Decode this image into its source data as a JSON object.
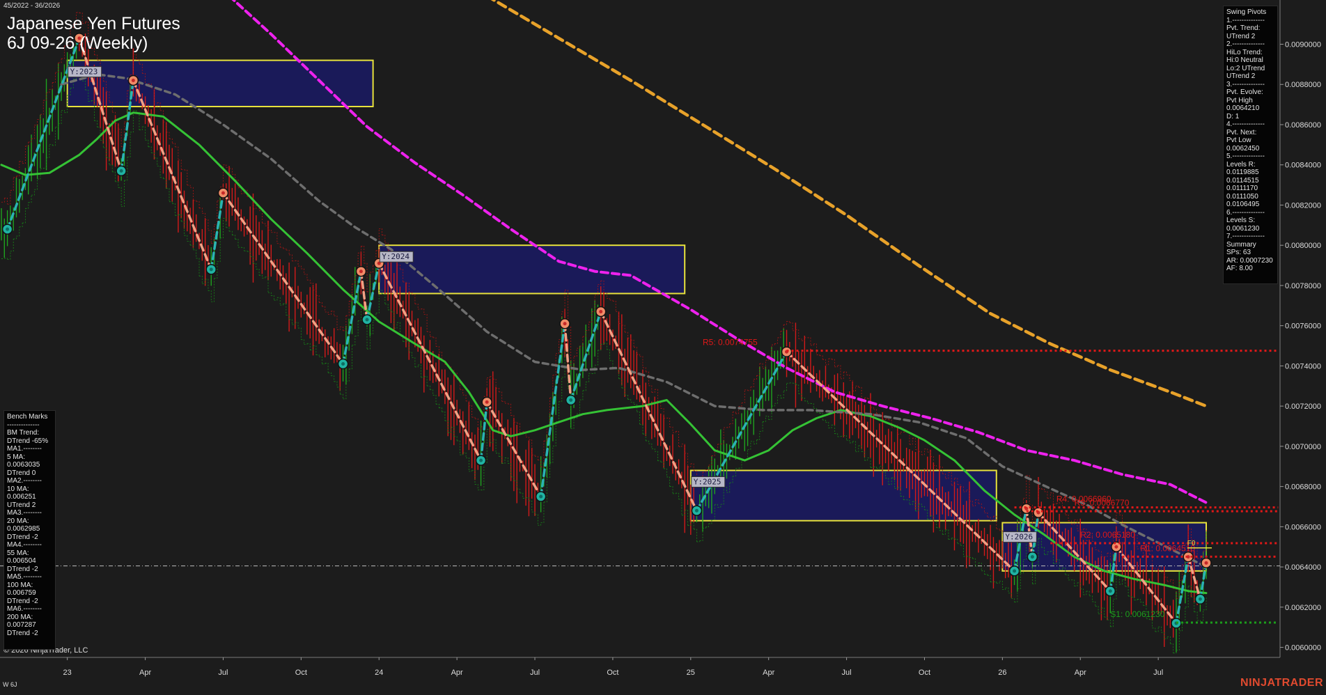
{
  "header": {
    "date_range": "45/2022 - 36/2026",
    "title": "Japanese Yen Futures",
    "subtitle": "6J 09-26 (Weekly)"
  },
  "footer": {
    "copyright": "© 2026 NinjaTrader, LLC",
    "series_label": "W 6J",
    "brand": "NINJATRADER"
  },
  "swing_panel": {
    "lines": [
      "Swing Pivots",
      "1.--------------",
      "Pvt. Trend:",
      "UTrend 2",
      "2.--------------",
      "HiLo Trend:",
      "Hi:0 Neutral",
      "Lo:2 UTrend",
      "UTrend 2",
      "3.--------------",
      "Pvt. Evolve:",
      "Pvt High",
      "0.0064210",
      "D: 1",
      "4.--------------",
      "Pvt. Next:",
      "Pvt Low",
      "0.0062450",
      "5.--------------",
      "Levels R:",
      "0.0119885",
      "0.0114515",
      "0.0111170",
      "0.0111050",
      "0.0106495",
      "6.--------------",
      "Levels S:",
      "0.0061230",
      "7.--------------",
      "Summary",
      "SPs: 63",
      "AR: 0.0007230",
      "AF: 8.00"
    ]
  },
  "bench_panel": {
    "lines": [
      "Bench Marks",
      "--------------",
      "BM Trend:",
      "DTrend -65%",
      "MA1.--------",
      "5 MA:",
      "0.0063035",
      "DTrend 0",
      "MA2.--------",
      "10 MA:",
      "0.006251",
      "UTrend 2",
      "MA3.--------",
      "20 MA:",
      "0.0062985",
      "DTrend -2",
      "MA4.--------",
      "55 MA:",
      "0.006504",
      "DTrend -2",
      "MA5.--------",
      "100 MA:",
      "0.006759",
      "DTrend -2",
      "MA6.--------",
      "200 MA:",
      "0.007287",
      "DTrend -2"
    ]
  },
  "colors": {
    "background": "#1c1c1c",
    "up_bar": "#1fa31f",
    "down_bar": "#d21a1a",
    "ma_green": "#35c235",
    "ma_gray": "#6e6e6e",
    "ma_magenta": "#ee22ee",
    "ma_orange": "#e8a22a",
    "swing_up": "#2ab3b3",
    "swing_down": "#f2a084",
    "resistance": "#e01818",
    "support": "#1c9e1c",
    "zone_fill": "#1a1a5e",
    "zone_border": "#e8e23c"
  },
  "chart_data": {
    "type": "line",
    "instrument": "6J 09-26",
    "timeframe": "Weekly",
    "ylim": [
      0.00595,
      0.00922
    ],
    "y_ticks": [
      "0.0090000",
      "0.0088000",
      "0.0086000",
      "0.0084000",
      "0.0082000",
      "0.0080000",
      "0.0078000",
      "0.0076000",
      "0.0074000",
      "0.0072000",
      "0.0070000",
      "0.0068000",
      "0.0066000",
      "0.0064000",
      "0.0062000",
      "0.0060000"
    ],
    "y_tick_values": [
      0.009,
      0.0088,
      0.0086,
      0.0084,
      0.0082,
      0.008,
      0.0078,
      0.0076,
      0.0074,
      0.0072,
      0.007,
      0.0068,
      0.0066,
      0.0064,
      0.0062,
      0.006
    ],
    "x_ticks": [
      {
        "label": "23",
        "week": 0
      },
      {
        "label": "Apr",
        "week": 13
      },
      {
        "label": "Jul",
        "week": 26
      },
      {
        "label": "Oct",
        "week": 39
      },
      {
        "label": "24",
        "week": 52
      },
      {
        "label": "Apr",
        "week": 65
      },
      {
        "label": "Jul",
        "week": 78
      },
      {
        "label": "Oct",
        "week": 91
      },
      {
        "label": "25",
        "week": 104
      },
      {
        "label": "Apr",
        "week": 117
      },
      {
        "label": "Jul",
        "week": 130
      },
      {
        "label": "Oct",
        "week": 143
      },
      {
        "label": "26",
        "week": 156
      },
      {
        "label": "Apr",
        "week": 169
      },
      {
        "label": "Jul",
        "week": 182
      }
    ],
    "x_range_weeks": [
      -11,
      190
    ],
    "swing_pivots": [
      {
        "w": -10,
        "v": 0.00808,
        "t": "L"
      },
      {
        "w": 2,
        "v": 0.00903,
        "t": "H"
      },
      {
        "w": 9,
        "v": 0.00837,
        "t": "L"
      },
      {
        "w": 11,
        "v": 0.00882,
        "t": "H"
      },
      {
        "w": 24,
        "v": 0.00788,
        "t": "L"
      },
      {
        "w": 26,
        "v": 0.00826,
        "t": "H"
      },
      {
        "w": 46,
        "v": 0.00741,
        "t": "L"
      },
      {
        "w": 49,
        "v": 0.00787,
        "t": "H"
      },
      {
        "w": 50,
        "v": 0.00763,
        "t": "L"
      },
      {
        "w": 52,
        "v": 0.00791,
        "t": "H"
      },
      {
        "w": 69,
        "v": 0.00693,
        "t": "L"
      },
      {
        "w": 70,
        "v": 0.00722,
        "t": "H"
      },
      {
        "w": 79,
        "v": 0.00675,
        "t": "L"
      },
      {
        "w": 83,
        "v": 0.00761,
        "t": "H"
      },
      {
        "w": 84,
        "v": 0.00723,
        "t": "L"
      },
      {
        "w": 89,
        "v": 0.00767,
        "t": "H"
      },
      {
        "w": 105,
        "v": 0.00668,
        "t": "L"
      },
      {
        "w": 120,
        "v": 0.00747,
        "t": "H"
      },
      {
        "w": 158,
        "v": 0.00638,
        "t": "L"
      },
      {
        "w": 160,
        "v": 0.00669,
        "t": "H"
      },
      {
        "w": 161,
        "v": 0.00645,
        "t": "L"
      },
      {
        "w": 162,
        "v": 0.00667,
        "t": "H"
      },
      {
        "w": 174,
        "v": 0.00628,
        "t": "L"
      },
      {
        "w": 175,
        "v": 0.0065,
        "t": "H"
      },
      {
        "w": 185,
        "v": 0.00612,
        "t": "L"
      },
      {
        "w": 187,
        "v": 0.00645,
        "t": "H"
      },
      {
        "w": 189,
        "v": 0.00624,
        "t": "L"
      },
      {
        "w": 190,
        "v": 0.00642,
        "t": "H"
      }
    ],
    "moving_averages": [
      {
        "name": "MA green",
        "color": "#35c235",
        "dash": "",
        "width": 3,
        "points": [
          [
            -11,
            0.0084
          ],
          [
            -7,
            0.00835
          ],
          [
            -3,
            0.00836
          ],
          [
            2,
            0.00845
          ],
          [
            5,
            0.00853
          ],
          [
            8,
            0.00862
          ],
          [
            11,
            0.00866
          ],
          [
            16,
            0.00864
          ],
          [
            22,
            0.0085
          ],
          [
            28,
            0.00832
          ],
          [
            34,
            0.00813
          ],
          [
            40,
            0.00796
          ],
          [
            46,
            0.00778
          ],
          [
            52,
            0.00762
          ],
          [
            58,
            0.00751
          ],
          [
            63,
            0.00742
          ],
          [
            67,
            0.00727
          ],
          [
            71,
            0.00708
          ],
          [
            74,
            0.00705
          ],
          [
            78,
            0.00708
          ],
          [
            82,
            0.00712
          ],
          [
            86,
            0.00716
          ],
          [
            90,
            0.00718
          ],
          [
            96,
            0.0072
          ],
          [
            100,
            0.00723
          ],
          [
            104,
            0.00711
          ],
          [
            108,
            0.00698
          ],
          [
            113,
            0.00693
          ],
          [
            117,
            0.00698
          ],
          [
            121,
            0.00708
          ],
          [
            125,
            0.00714
          ],
          [
            129,
            0.00718
          ],
          [
            134,
            0.00715
          ],
          [
            139,
            0.00709
          ],
          [
            143,
            0.00703
          ],
          [
            148,
            0.00693
          ],
          [
            153,
            0.00678
          ],
          [
            158,
            0.00666
          ],
          [
            163,
            0.00656
          ],
          [
            168,
            0.00645
          ],
          [
            173,
            0.00638
          ],
          [
            178,
            0.00634
          ],
          [
            183,
            0.00631
          ],
          [
            187,
            0.00628
          ],
          [
            190,
            0.00627
          ]
        ]
      },
      {
        "name": "MA gray",
        "color": "#6e6e6e",
        "dash": "8 6",
        "width": 3.5,
        "points": [
          [
            -1,
            0.0088
          ],
          [
            5,
            0.00885
          ],
          [
            10,
            0.00883
          ],
          [
            18,
            0.00875
          ],
          [
            26,
            0.0086
          ],
          [
            34,
            0.00843
          ],
          [
            42,
            0.00822
          ],
          [
            48,
            0.00809
          ],
          [
            54,
            0.00798
          ],
          [
            62,
            0.00778
          ],
          [
            70,
            0.00757
          ],
          [
            78,
            0.00742
          ],
          [
            86,
            0.00738
          ],
          [
            92,
            0.00739
          ],
          [
            100,
            0.00732
          ],
          [
            108,
            0.0072
          ],
          [
            116,
            0.00718
          ],
          [
            124,
            0.00718
          ],
          [
            134,
            0.00716
          ],
          [
            142,
            0.00712
          ],
          [
            150,
            0.00704
          ],
          [
            156,
            0.0069
          ],
          [
            164,
            0.00679
          ],
          [
            170,
            0.00671
          ],
          [
            176,
            0.00661
          ],
          [
            182,
            0.00652
          ],
          [
            188,
            0.00643
          ],
          [
            190,
            0.0064
          ]
        ]
      },
      {
        "name": "MA magenta",
        "color": "#ee22ee",
        "dash": "10 6",
        "width": 4,
        "points": [
          [
            27,
            0.00924
          ],
          [
            34,
            0.00905
          ],
          [
            42,
            0.00882
          ],
          [
            50,
            0.00859
          ],
          [
            58,
            0.00841
          ],
          [
            66,
            0.00825
          ],
          [
            74,
            0.00808
          ],
          [
            82,
            0.00792
          ],
          [
            88,
            0.00787
          ],
          [
            94,
            0.00785
          ],
          [
            104,
            0.00768
          ],
          [
            112,
            0.00753
          ],
          [
            120,
            0.00739
          ],
          [
            128,
            0.00727
          ],
          [
            136,
            0.0072
          ],
          [
            144,
            0.00714
          ],
          [
            152,
            0.00707
          ],
          [
            160,
            0.00698
          ],
          [
            168,
            0.00693
          ],
          [
            176,
            0.00686
          ],
          [
            184,
            0.00681
          ],
          [
            190,
            0.00672
          ]
        ]
      },
      {
        "name": "MA orange",
        "color": "#e8a22a",
        "dash": "12 7",
        "width": 4.5,
        "points": [
          [
            70,
            0.00924
          ],
          [
            82,
            0.00903
          ],
          [
            94,
            0.00882
          ],
          [
            106,
            0.0086
          ],
          [
            118,
            0.00838
          ],
          [
            130,
            0.00815
          ],
          [
            142,
            0.0079
          ],
          [
            154,
            0.00766
          ],
          [
            164,
            0.00751
          ],
          [
            174,
            0.00738
          ],
          [
            184,
            0.00727
          ],
          [
            190,
            0.0072
          ]
        ]
      }
    ],
    "zones": [
      {
        "label": "Y:2023",
        "w1": 0,
        "w2": 51,
        "v_top": 0.00892,
        "v_bot": 0.00869
      },
      {
        "label": "Y:2024",
        "w1": 52,
        "w2": 103,
        "v_top": 0.008,
        "v_bot": 0.00776
      },
      {
        "label": "Y:2025",
        "w1": 104,
        "w2": 155,
        "v_top": 0.00688,
        "v_bot": 0.00663
      },
      {
        "label": "Y:2026",
        "w1": 156,
        "w2": 190,
        "v_top": 0.00662,
        "v_bot": 0.00638
      }
    ],
    "levels": [
      {
        "label": "R5: 0.0074755",
        "value": 0.0074755,
        "w1": 120,
        "w2": 202,
        "color": "#e01818",
        "label_w": 106
      },
      {
        "label": "R4: 0.0066960",
        "value": 0.006696,
        "w1": 158,
        "w2": 202,
        "color": "#e01818",
        "label_w": 165
      },
      {
        "label": "R3: 0.0066770",
        "value": 0.006677,
        "w1": 160,
        "w2": 202,
        "color": "#e01818",
        "label_w": 168
      },
      {
        "label": "R2: 0.0065180",
        "value": 0.006518,
        "w1": 164,
        "w2": 202,
        "color": "#e01818",
        "label_w": 169
      },
      {
        "label": "R1: 0.0064510",
        "value": 0.006451,
        "w1": 176,
        "w2": 202,
        "color": "#e01818",
        "label_w": 179
      },
      {
        "label": "S1: 0.0061230",
        "value": 0.006123,
        "w1": 185,
        "w2": 202,
        "color": "#1c9e1c",
        "label_w": 174
      }
    ],
    "current_price": 0.006405,
    "f0_label": "F0",
    "f0_value": 0.006505,
    "f0_week": 188
  }
}
